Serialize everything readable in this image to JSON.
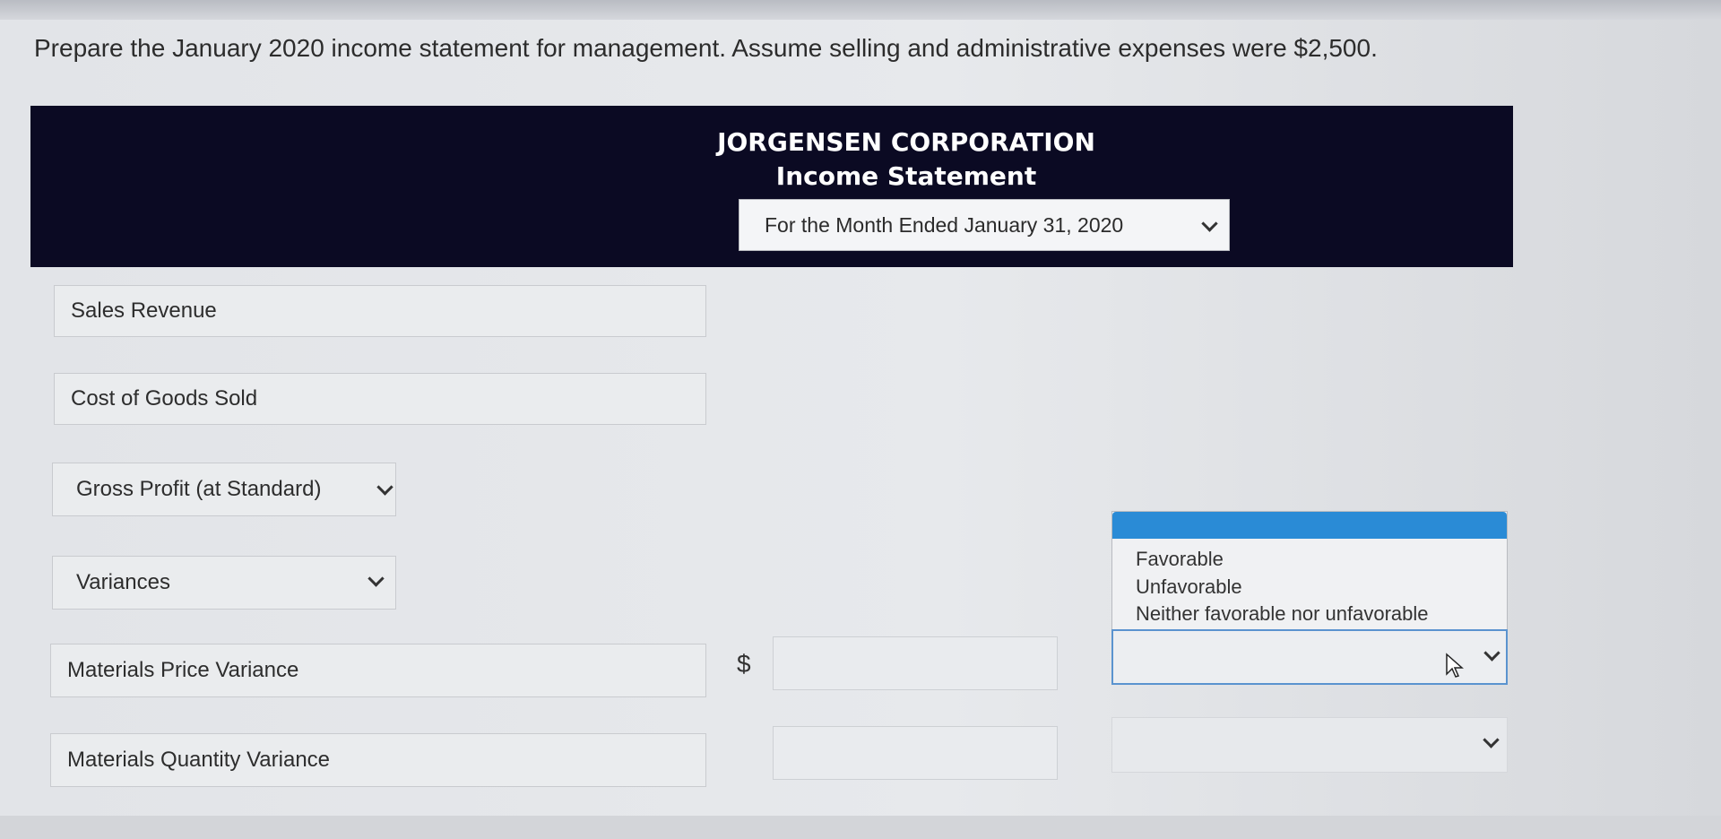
{
  "question": "Prepare the January 2020 income statement for management. Assume selling and administrative expenses were $2,500.",
  "header": {
    "company": "JORGENSEN CORPORATION",
    "statement": "Income Statement",
    "period": "For the Month Ended January 31, 2020"
  },
  "rows": {
    "sales_revenue": "Sales Revenue",
    "cost_of_goods_sold": "Cost of Goods Sold",
    "gross_profit": "Gross Profit (at Standard)",
    "variances": "Variances",
    "materials_price_variance": "Materials Price Variance",
    "materials_quantity_variance": "Materials Quantity Variance"
  },
  "currency_symbol": "$",
  "variance_dropdown": {
    "options": [
      "Favorable",
      "Unfavorable",
      "Neither favorable nor unfavorable"
    ]
  },
  "colors": {
    "header_band": "#0b0a23",
    "dropdown_highlight": "#2a8bd6",
    "active_border": "#5a93cf"
  }
}
